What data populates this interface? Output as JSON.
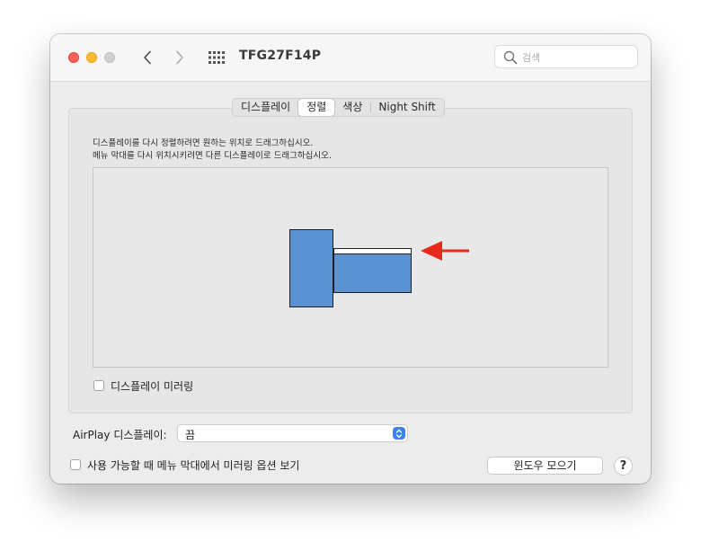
{
  "window": {
    "title": "TFG27F14P",
    "search_placeholder": "검색"
  },
  "tabs": [
    {
      "label": "디스플레이",
      "active": false
    },
    {
      "label": "정렬",
      "active": true
    },
    {
      "label": "색상",
      "active": false
    },
    {
      "label": "Night Shift",
      "active": false
    }
  ],
  "arrangement": {
    "instruction_line1": "디스플레이를 다시 정렬하려면 원하는 위치로 드래그하십시오.",
    "instruction_line2": "메뉴 막대를 다시 위치시키려면 다른 디스플레이로 드래그하십시오."
  },
  "mirror": {
    "label": "디스플레이 미러링",
    "checked": false
  },
  "airplay": {
    "label": "AirPlay 디스플레이:",
    "selected": "끔"
  },
  "menubar_option": {
    "label": "사용 가능할 때 메뉴 막대에서 미러링 옵션 보기",
    "checked": false
  },
  "buttons": {
    "gather_windows": "윈도우 모으기",
    "help": "?"
  },
  "colors": {
    "display_fill": "#5b92d4",
    "arrow": "#e8291c",
    "select_accent": "#3b82f6"
  }
}
